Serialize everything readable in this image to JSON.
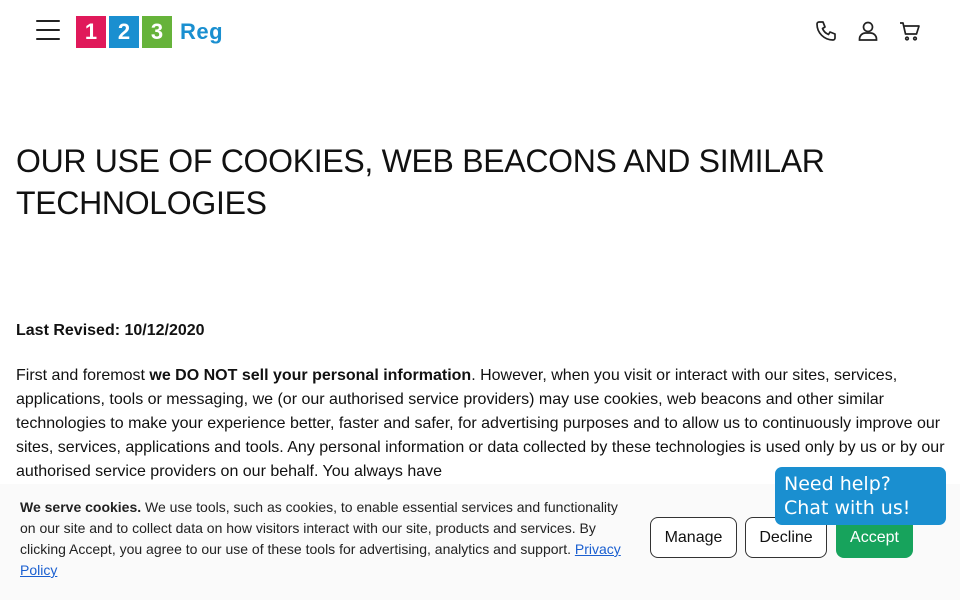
{
  "header": {
    "logo": {
      "digits": [
        "1",
        "2",
        "3"
      ],
      "text": "Reg",
      "colors": [
        "#e0195a",
        "#1a8fd0",
        "#66b33a"
      ]
    },
    "icons": [
      "menu-icon",
      "phone-icon",
      "account-icon",
      "cart-icon"
    ]
  },
  "main": {
    "title": "OUR USE OF COOKIES, WEB BEACONS AND SIMILAR TECHNOLOGIES",
    "revised": "Last Revised: 10/12/2020",
    "paragraph": {
      "prefix": "First and foremost ",
      "bold": "we DO NOT sell your personal information",
      "suffix": ". However, when you visit or interact with our sites, services, applications, tools or messaging, we (or our authorised service providers) may use cookies, web beacons and other similar technologies to make your experience better, faster and safer, for advertising purposes and to allow us to continuously improve our sites, services, applications and tools. Any personal information or data collected by these technologies is used only by us or by our authorised service providers on our behalf. You always have"
    }
  },
  "chat": {
    "label": "Need help? Chat with us!"
  },
  "cookie_banner": {
    "heading": "We serve cookies.",
    "text": " We use tools, such as cookies, to enable essential services and functionality on our site and to collect data on how visitors interact with our site, products and services. By clicking Accept, you agree to our use of these tools for advertising, analytics and support. ",
    "link": "Privacy Policy",
    "buttons": {
      "manage": "Manage",
      "decline": "Decline",
      "accept": "Accept"
    },
    "accept_color": "#17a35c"
  }
}
